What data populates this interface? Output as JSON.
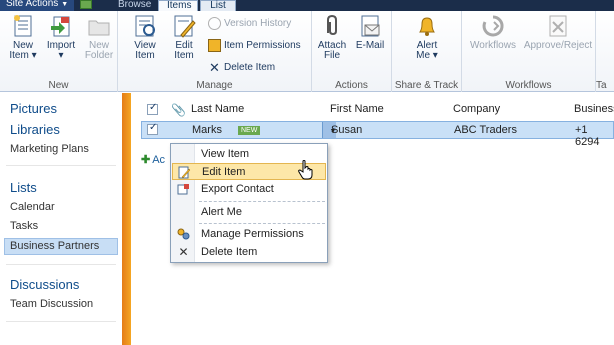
{
  "top": {
    "site_actions": "Site Actions",
    "tabs": [
      "Browse",
      "Items",
      "List"
    ]
  },
  "ribbon": {
    "groups": {
      "new": "New",
      "manage": "Manage",
      "actions": "Actions",
      "share_track": "Share & Track",
      "workflows": "Workflows",
      "overflow": "Ta"
    },
    "buttons": {
      "new_item": [
        "New",
        "Item ▾"
      ],
      "import": [
        "Import",
        "▾"
      ],
      "new_folder": [
        "New",
        "Folder"
      ],
      "view_item": [
        "View",
        "Item"
      ],
      "edit_item": [
        "Edit",
        "Item"
      ],
      "version_history": "Version History",
      "item_permissions": "Item Permissions",
      "delete_item": "Delete Item",
      "attach_file": [
        "Attach",
        "File"
      ],
      "email": "E-Mail",
      "alert_me": [
        "Alert",
        "Me ▾"
      ],
      "workflows": "Workflows",
      "approve_reject": "Approve/Reject"
    }
  },
  "leftnav": {
    "pictures": "Pictures",
    "libraries": "Libraries",
    "marketing_plans": "Marketing Plans",
    "lists": "Lists",
    "calendar": "Calendar",
    "tasks": "Tasks",
    "business_partners": "Business Partners",
    "discussions": "Discussions",
    "team_discussion": "Team Discussion"
  },
  "list": {
    "columns": [
      "Last Name",
      "First Name",
      "Company",
      "Business"
    ],
    "row": {
      "last_name": "Marks",
      "badge": "NEW",
      "first_name": "Susan",
      "company": "ABC Traders",
      "phone": "+1 6294"
    },
    "add_new": "Ac"
  },
  "menu": {
    "items": [
      "View Item",
      "Edit Item",
      "Export Contact",
      "Alert Me",
      "Manage Permissions",
      "Delete Item"
    ]
  }
}
